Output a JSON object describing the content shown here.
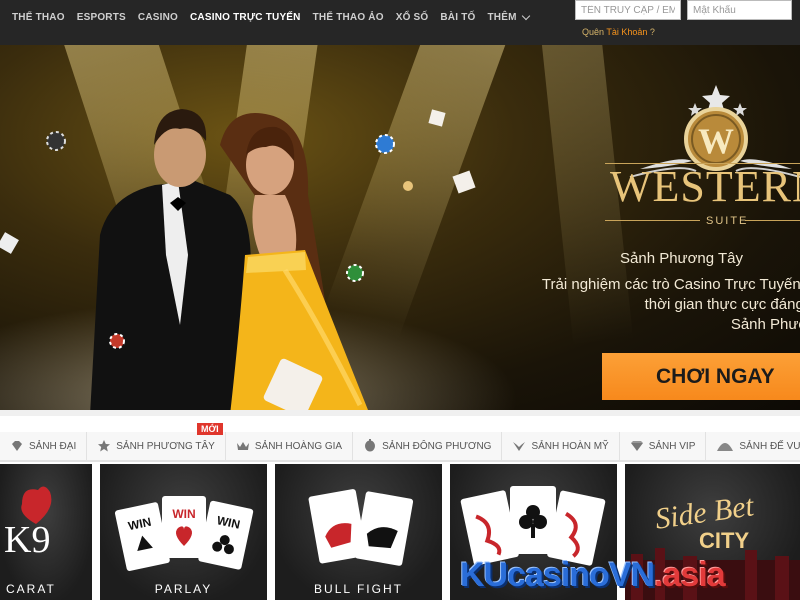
{
  "nav": {
    "items": [
      {
        "label": "THỂ THAO"
      },
      {
        "label": "ESPORTS"
      },
      {
        "label": "CASINO"
      },
      {
        "label": "CASINO TRỰC TUYẾN",
        "active": true
      },
      {
        "label": "THỂ THAO ẢO"
      },
      {
        "label": "XỔ SỐ"
      },
      {
        "label": "BÀI TỐ"
      },
      {
        "label": "THÊM"
      }
    ],
    "more_icon": "chevron-down-icon"
  },
  "login": {
    "username_placeholder": "TÊN TRUY CẬP / EMAIL",
    "password_placeholder": "Mật Khẩu",
    "forgot_prefix": "Quên ",
    "forgot_link": "Tài Khoản",
    "forgot_suffix": " ?"
  },
  "hero": {
    "logo_letter": "W",
    "brand": "WESTERN",
    "suite": "SUITE",
    "title": "Sảnh Phương Tây",
    "desc_lines": [
      "Trải nghiệm các trò Casino Trực Tuyến mới lạ v",
      "thời gian thực cực đáng trải ngh",
      "Sảnh Phương Tây!"
    ],
    "cta": "CHƠI NGAY"
  },
  "tabs": {
    "items": [
      {
        "label": "SẢNH ĐẠI",
        "icon": "diamond-icon"
      },
      {
        "label": "SẢNH PHƯƠNG TÂY",
        "icon": "star-icon"
      },
      {
        "label": "SẢNH HOÀNG GIA",
        "icon": "crown-icon"
      },
      {
        "label": "SẢNH ĐÔNG PHƯƠNG",
        "icon": "lantern-icon"
      },
      {
        "label": "SẢNH HOÀN MỸ",
        "icon": "wings-icon"
      },
      {
        "label": "SẢNH VIP",
        "icon": "gem-icon"
      },
      {
        "label": "SẢNH ĐẾ VƯƠNG",
        "icon": "fan-icon"
      }
    ],
    "new_badge": "MỚI"
  },
  "games": [
    {
      "label": "CARAT",
      "art": "K9"
    },
    {
      "label": "PARLAY",
      "art_word": "WIN"
    },
    {
      "label": "BULL FIGHT"
    },
    {
      "label": ""
    },
    {
      "label": "",
      "art_line1": "Side Bet",
      "art_line2": "CITY"
    }
  ],
  "watermark": {
    "blue": "KUcasinoVN",
    "red": ".asia"
  },
  "colors": {
    "accent": "#f7941d",
    "gold": "#e8c47a",
    "badge": "#e0362c"
  }
}
